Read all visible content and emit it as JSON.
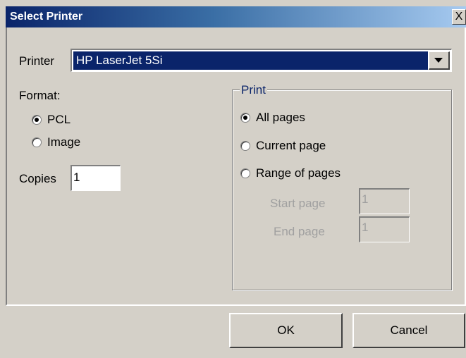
{
  "window": {
    "title": "Select Printer",
    "close_symbol": "X"
  },
  "printer": {
    "label": "Printer",
    "selected": "HP LaserJet 5Si"
  },
  "format": {
    "label": "Format:",
    "options": [
      {
        "label": "PCL",
        "checked": true
      },
      {
        "label": "Image",
        "checked": false
      }
    ]
  },
  "copies": {
    "label": "Copies",
    "value": "1"
  },
  "print_group": {
    "title": "Print",
    "options": [
      {
        "label": "All pages",
        "checked": true
      },
      {
        "label": "Current page",
        "checked": false
      },
      {
        "label": "Range of pages",
        "checked": false
      }
    ],
    "start_page": {
      "label": "Start page",
      "value": "1"
    },
    "end_page": {
      "label": "End page",
      "value": "1"
    }
  },
  "buttons": {
    "ok": "OK",
    "cancel": "Cancel"
  },
  "colors": {
    "title_bar": "#0a246a",
    "dialog_bg": "#d4d0c8",
    "selection": "#0a246a",
    "group_title": "#0a246a",
    "disabled_text": "#a0a0a0"
  }
}
